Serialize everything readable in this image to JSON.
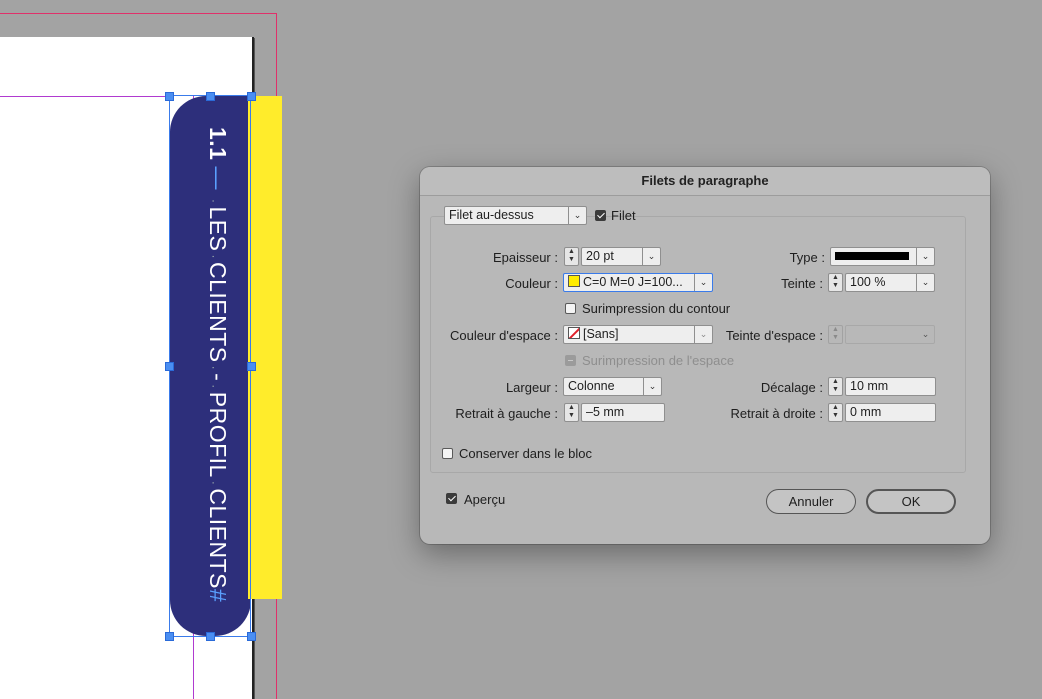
{
  "canvas": {
    "tab_number": "1.1",
    "tab_dash": "—",
    "tab_text_1": "LES",
    "tab_text_2": "CLIENTS",
    "tab_text_3": "-",
    "tab_text_4": "PROFIL",
    "tab_text_5": "CLIENTS",
    "tab_hash": "#",
    "dot": "·",
    "tab_color": "#2d2f7b",
    "bar_color": "#ffec2b"
  },
  "dialog": {
    "title": "Filets de paragraphe",
    "rule_position": "Filet au-dessus",
    "rule_on_label": "Filet",
    "weight_label": "Epaisseur :",
    "weight_value": "20 pt",
    "type_label": "Type :",
    "color_label": "Couleur :",
    "color_value": "C=0 M=0 J=100...",
    "tint_label": "Teinte :",
    "tint_value": "100 %",
    "overprint_stroke_label": "Surimpression du contour",
    "gap_color_label": "Couleur d'espace :",
    "gap_color_value": "[Sans]",
    "gap_tint_label": "Teinte d'espace :",
    "overprint_gap_label": "Surimpression de l'espace",
    "width_label": "Largeur :",
    "width_value": "Colonne",
    "offset_label": "Décalage :",
    "offset_value": "10 mm",
    "left_indent_label": "Retrait à gauche :",
    "left_indent_value": "–5 mm",
    "right_indent_label": "Retrait à droite :",
    "right_indent_value": "0 mm",
    "keep_in_frame_label": "Conserver dans le bloc",
    "preview_label": "Aperçu",
    "cancel_label": "Annuler",
    "ok_label": "OK"
  }
}
